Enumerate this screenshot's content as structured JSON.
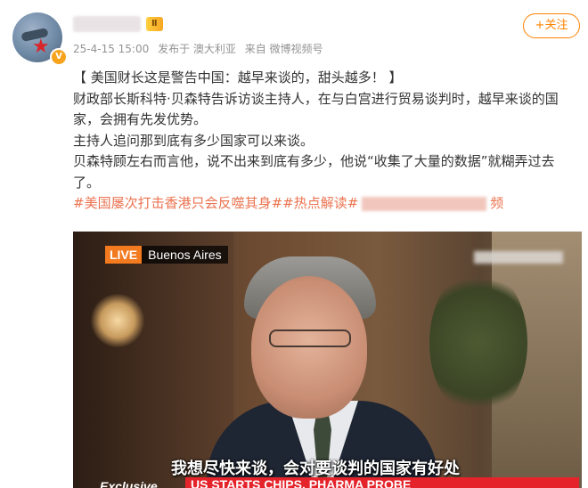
{
  "header": {
    "verified_badge": "V",
    "level_label": "Ⅱ",
    "follow_label": "+关注"
  },
  "meta": {
    "timestamp": "25-4-15 15:00",
    "published_in": "发布于 澳大利亚",
    "source": "来自 微博视频号"
  },
  "post": {
    "headline": "【 美国财长这是警告中国：越早来谈的，甜头越多！ 】",
    "paragraphs": [
      "财政部长斯科特·贝森特告诉访谈主持人，在与白宫进行贸易谈判时，越早来谈的国家，会拥有先发优势。",
      "主持人追问那到底有多少国家可以来谈。",
      "贝森特顾左右而言他，说不出来到底有多少，他说“收集了大量的数据”就糊弄过去了。"
    ],
    "tags": "#美国屡次打击香港只会反噬其身##热点解读#",
    "tag_tail": "频"
  },
  "video": {
    "live_label": "LIVE",
    "location": "Buenos Aires",
    "subtitle": "我想尽快来谈，会对要谈判的国家有好处",
    "exclusive_label": "Exclusive",
    "ticker": "US STARTS CHIPS, PHARMA PROBE"
  },
  "colors": {
    "accent": "#ff8200",
    "tag": "#eb7350",
    "live": "#f37a1f",
    "ticker": "#e5232b"
  },
  "icons": {
    "avatar": "fighter-jet-star-avatar",
    "verified": "verified-v-icon"
  }
}
